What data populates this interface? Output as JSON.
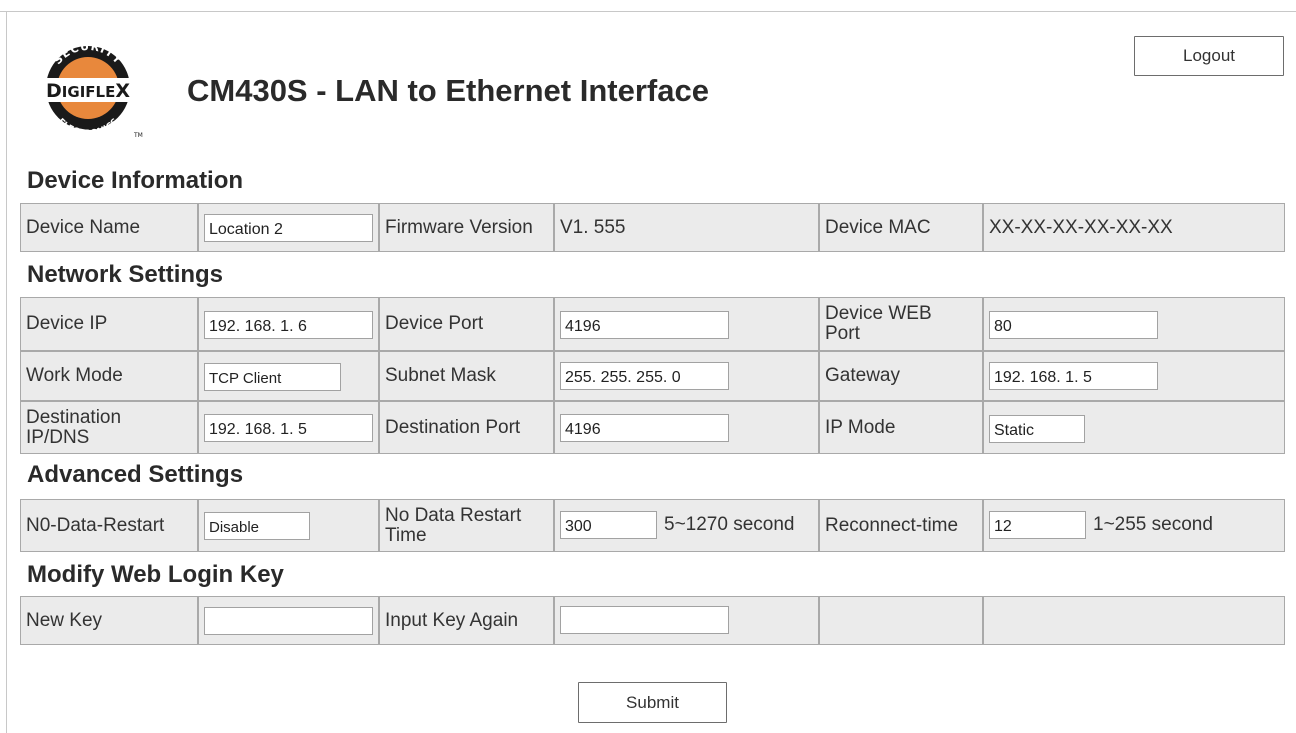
{
  "header": {
    "logo": {
      "top_text": "SECURITY",
      "brand": "DIGIFLEX",
      "bottom_text": "ELECTRONICS",
      "trademark": "TM",
      "brand_color": "#e8883c"
    },
    "title": "CM430S - LAN to Ethernet Interface",
    "logout_label": "Logout"
  },
  "device_info": {
    "section_title": "Device Information",
    "device_name_label": "Device Name",
    "device_name_value": "Location 2",
    "firmware_label": "Firmware Version",
    "firmware_value": "V1. 555",
    "mac_label": "Device MAC",
    "mac_value": "XX-XX-XX-XX-XX-XX"
  },
  "network": {
    "section_title": "Network Settings",
    "device_ip_label": "Device IP",
    "device_ip_value": "192. 168. 1. 6",
    "device_port_label": "Device Port",
    "device_port_value": "4196",
    "web_port_label": "Device WEB Port",
    "web_port_value": "80",
    "work_mode_label": "Work Mode",
    "work_mode_value": "TCP Client",
    "subnet_label": "Subnet Mask",
    "subnet_value": "255. 255. 255. 0",
    "gateway_label": "Gateway",
    "gateway_value": "192. 168. 1. 5",
    "dest_ip_label": "Destination IP/DNS",
    "dest_ip_value": "192. 168. 1. 5",
    "dest_port_label": "Destination Port",
    "dest_port_value": "4196",
    "ip_mode_label": "IP Mode",
    "ip_mode_value": "Static"
  },
  "advanced": {
    "section_title": "Advanced Settings",
    "no_data_restart_label": "N0-Data-Restart",
    "no_data_restart_value": "Disable",
    "restart_time_label": "No Data Restart Time",
    "restart_time_value": "300",
    "restart_time_range": "5~1270 second",
    "reconnect_label": "Reconnect-time",
    "reconnect_value": "12",
    "reconnect_range": "1~255 second"
  },
  "login_key": {
    "section_title": "Modify Web Login Key",
    "new_key_label": "New Key",
    "new_key_value": "",
    "again_label": "Input Key Again",
    "again_value": ""
  },
  "submit_label": "Submit"
}
